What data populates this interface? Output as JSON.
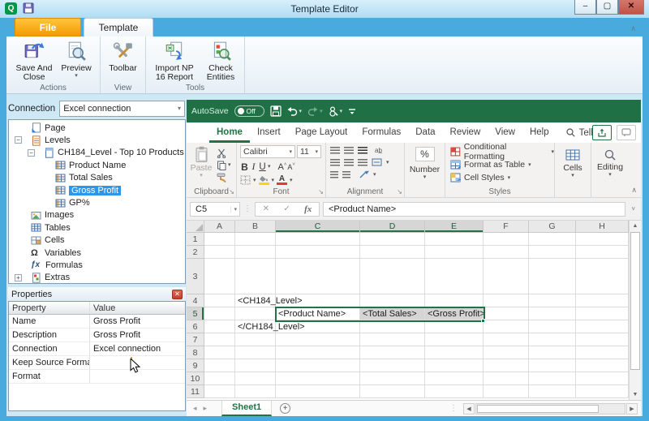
{
  "window": {
    "title": "Template Editor",
    "minimize": "–",
    "maximize": "▢",
    "close": "✕"
  },
  "app_tabs": {
    "file": "File",
    "template": "Template"
  },
  "app_ribbon": {
    "groups": [
      {
        "label": "Actions"
      },
      {
        "label": "View"
      },
      {
        "label": "Tools"
      }
    ],
    "buttons": {
      "save_and_close": "Save And Close",
      "preview": "Preview",
      "toolbar": "Toolbar",
      "import_np": "Import NP 16 Report",
      "check_entities": "Check Entities"
    }
  },
  "sidebar": {
    "connection_label": "Connection",
    "connection_value": "Excel connection",
    "glyphs": {
      "variables": "Ω",
      "formulas": "ƒx"
    },
    "tree": [
      {
        "label": "Page"
      },
      {
        "label": "Levels",
        "expander": "−"
      },
      {
        "label": "CH184_Level - Top 10 Products",
        "expander": "−"
      },
      {
        "label": "Product Name"
      },
      {
        "label": "Total Sales"
      },
      {
        "label": "Gross Profit"
      },
      {
        "label": "GP%"
      },
      {
        "label": "Images"
      },
      {
        "label": "Tables"
      },
      {
        "label": "Cells"
      },
      {
        "label": "Variables"
      },
      {
        "label": "Formulas"
      },
      {
        "label": "Extras",
        "expander": "+"
      }
    ]
  },
  "properties": {
    "title": "Properties",
    "columns": [
      "Property",
      "Value"
    ],
    "rows": [
      {
        "property": "Name",
        "value": "Gross Profit"
      },
      {
        "property": "Description",
        "value": "Gross Profit"
      },
      {
        "property": "Connection",
        "value": "Excel connection"
      },
      {
        "property": "Keep Source Formats",
        "value": ""
      },
      {
        "property": "Format",
        "value": ""
      }
    ]
  },
  "excel": {
    "qat": {
      "autosave": "AutoSave",
      "autosave_state": "Off"
    },
    "tabs": [
      "Home",
      "Insert",
      "Page Layout",
      "Formulas",
      "Data",
      "Review",
      "View",
      "Help"
    ],
    "tell_me": "Tell me",
    "ribbon": {
      "paste": "Paste",
      "clipboard": "Clipboard",
      "font_name": "Calibri",
      "font_size": "11",
      "font": "Font",
      "bold": "B",
      "italic": "I",
      "underline": "U",
      "alignment": "Alignment",
      "percent": "%",
      "number": "Number",
      "conditional_formatting": "Conditional Formatting",
      "format_as_table": "Format as Table",
      "cell_styles": "Cell Styles",
      "styles": "Styles",
      "cells": "Cells",
      "editing": "Editing"
    },
    "formula_bar": {
      "name_box": "C5",
      "fx": "fx",
      "formula": "<Product Name>"
    },
    "grid": {
      "columns": [
        "A",
        "B",
        "C",
        "D",
        "E",
        "F",
        "G",
        "H"
      ],
      "rows": [
        "1",
        "2",
        "3",
        "4",
        "5",
        "6",
        "7",
        "8",
        "9",
        "10",
        "11"
      ],
      "selected_columns": [
        "C",
        "D",
        "E"
      ],
      "selected_row": "5",
      "cells": [
        {
          "col": "B",
          "row": "4",
          "text": "<CH184_Level>"
        },
        {
          "col": "C",
          "row": "5",
          "text": "<Product Name>",
          "active": true
        },
        {
          "col": "D",
          "row": "5",
          "text": "<Total Sales>",
          "fill": true
        },
        {
          "col": "E",
          "row": "5",
          "text": "<Gross Profit>",
          "fill": true
        },
        {
          "col": "B",
          "row": "6",
          "text": "</CH184_Level>"
        }
      ]
    },
    "sheet": {
      "name": "Sheet1"
    }
  },
  "colors": {
    "excel_green": "#217346",
    "selection_blue": "#2e96e8",
    "file_tab_orange": "#f49a00"
  }
}
